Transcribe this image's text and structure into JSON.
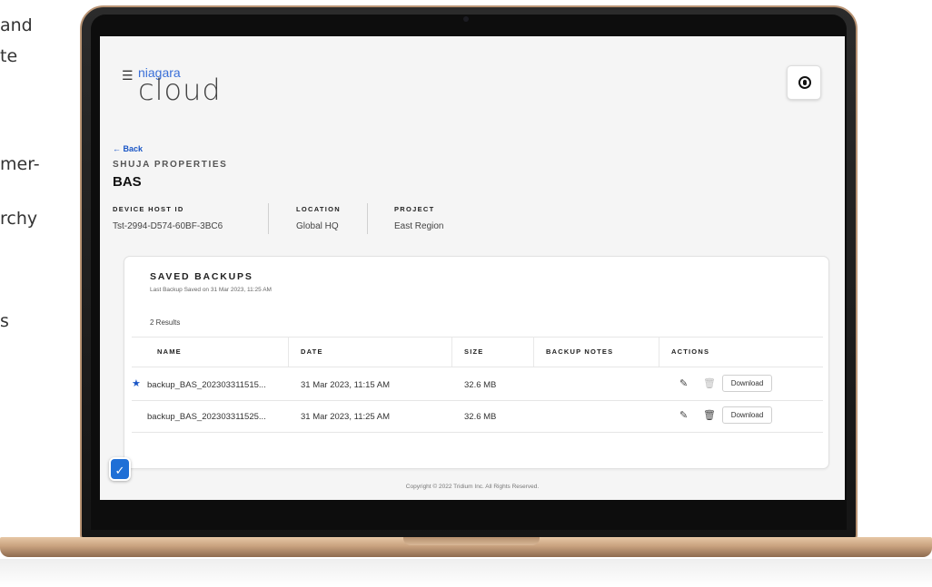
{
  "side_text": [
    "and",
    "te",
    "mer-",
    "rchy",
    "s"
  ],
  "app": {
    "logo_top": "niagara",
    "logo_bottom": "cloud",
    "hamburger_icon": "hamburger-icon",
    "user_icon": "user-icon"
  },
  "header": {
    "back_label": "← Back",
    "company": "SHUJA PROPERTIES",
    "title": "BAS"
  },
  "meta": [
    {
      "label": "DEVICE HOST ID",
      "value": "Tst-2994-D574-60BF-3BC6"
    },
    {
      "label": "LOCATION",
      "value": "Global HQ"
    },
    {
      "label": "PROJECT",
      "value": "East Region"
    }
  ],
  "backups": {
    "title": "SAVED BACKUPS",
    "subtitle": "Last Backup Saved on 31 Mar 2023, 11:25 AM",
    "results": "2 Results",
    "columns": [
      "NAME",
      "DATE",
      "SIZE",
      "BACKUP NOTES",
      "ACTIONS"
    ],
    "rows": [
      {
        "starred": true,
        "name": "backup_BAS_202303311515...",
        "date": "31 Mar 2023, 11:15 AM",
        "size": "32.6 MB",
        "notes": "",
        "download": "Download"
      },
      {
        "starred": false,
        "name": "backup_BAS_202303311525...",
        "date": "31 Mar 2023, 11:25 AM",
        "size": "32.6 MB",
        "notes": "",
        "download": "Download"
      }
    ]
  },
  "footer": "Copyright © 2022 Tridium Inc. All Rights Reserved.",
  "colors": {
    "accent": "#1a56c6",
    "badge": "#1f6fd6",
    "laptop_frame": "#c9a27f"
  }
}
